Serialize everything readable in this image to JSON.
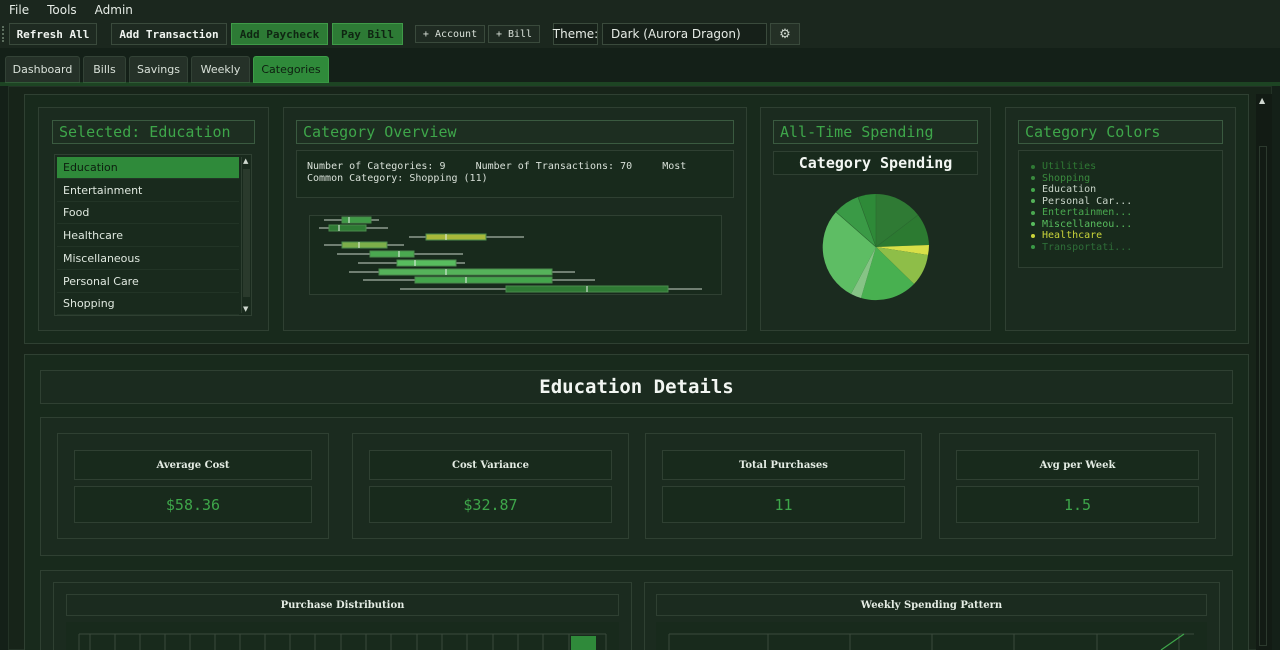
{
  "menu": [
    "File",
    "Tools",
    "Admin"
  ],
  "toolbar": {
    "refresh_all": "Refresh All",
    "add_transaction": "Add Transaction",
    "add_paycheck": "Add Paycheck",
    "pay_bill": "Pay Bill",
    "add_account": "+ Account",
    "add_bill": "+ Bill",
    "theme_label": "Theme:",
    "theme_value": "Dark (Aurora Dragon)"
  },
  "tabs": [
    "Dashboard",
    "Bills",
    "Savings",
    "Weekly",
    "Categories"
  ],
  "active_tab": "Categories",
  "selected_panel": {
    "title": "Selected: Education",
    "items": [
      "Education",
      "Entertainment",
      "Food",
      "Healthcare",
      "Miscellaneous",
      "Personal Care",
      "Shopping"
    ],
    "selected": "Education"
  },
  "overview": {
    "title": "Category Overview",
    "line1_a": "Number of Categories: 9",
    "line1_b": "Number of Transactions: 70",
    "line1_c": "Most",
    "line2": "Common Category: Shopping (11)"
  },
  "spending": {
    "title": "All-Time Spending",
    "chart_title": "Category Spending"
  },
  "colors_panel": {
    "title": "Category Colors",
    "items": [
      {
        "label": "Utilities",
        "color": "#2f7a34"
      },
      {
        "label": "Shopping",
        "color": "#3a8a3e"
      },
      {
        "label": "Education",
        "color": "#44a64c"
      },
      {
        "label": "Personal Car...",
        "color": "#55b35a"
      },
      {
        "label": "Entertainmen...",
        "color": "#4aa850"
      },
      {
        "label": "Miscellaneou...",
        "color": "#58bd5e"
      },
      {
        "label": "Healthcare",
        "color": "#c9d43a"
      },
      {
        "label": "Transportati...",
        "color": "#3a9a46"
      }
    ]
  },
  "details": {
    "title": "Education Details",
    "stats": [
      {
        "label": "Average Cost",
        "value": "$58.36"
      },
      {
        "label": "Cost Variance",
        "value": "$32.87"
      },
      {
        "label": "Total Purchases",
        "value": "11"
      },
      {
        "label": "Avg per Week",
        "value": "1.5"
      }
    ],
    "purchase_distribution": "Purchase Distribution",
    "weekly_pattern": "Weekly Spending Pattern"
  },
  "colors": {
    "accent": "#2f8a3a",
    "accent_text": "#3ea64a",
    "background": "#142018"
  }
}
